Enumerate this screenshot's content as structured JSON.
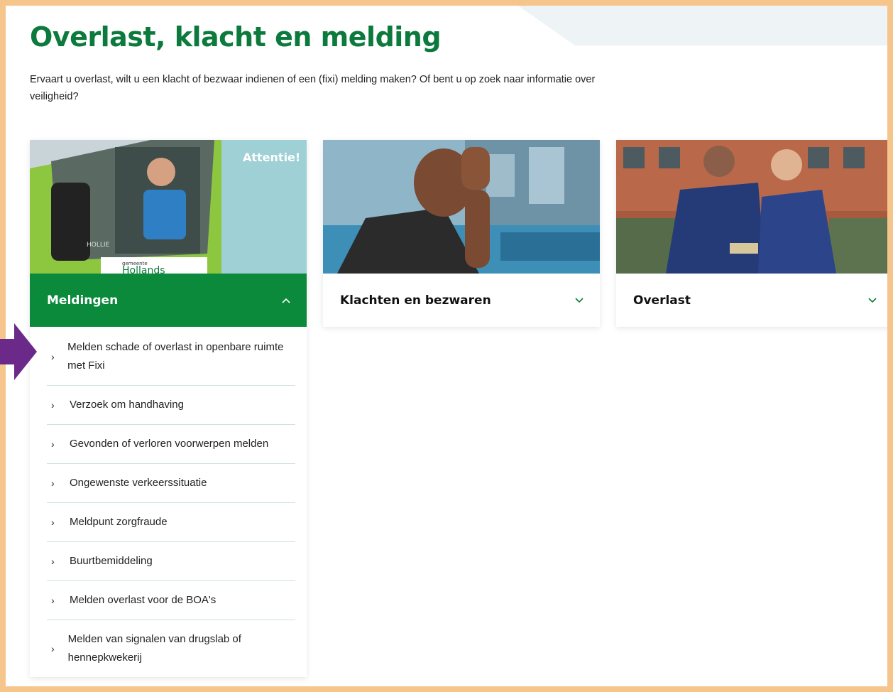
{
  "page": {
    "title": "Overlast, klacht en melding",
    "intro": "Ervaart u overlast, wilt u een klacht of bezwaar indienen of een (fixi) melding maken? Of bent u op zoek naar informatie over veiligheid?"
  },
  "cards": [
    {
      "label": "Meldingen",
      "chevron_icon": "chevron-up-icon",
      "image_text": [
        "Attentie!",
        "gemeente",
        "Hollands",
        "HOLLIE"
      ],
      "items": [
        {
          "label": "Melden schade of overlast in openbare ruimte met Fixi"
        },
        {
          "label": "Verzoek om handhaving"
        },
        {
          "label": "Gevonden of verloren voorwerpen melden"
        },
        {
          "label": "Ongewenste verkeerssituatie"
        },
        {
          "label": "Meldpunt zorgfraude"
        },
        {
          "label": "Buurtbemiddeling"
        },
        {
          "label": "Melden overlast voor de BOA's"
        },
        {
          "label": "Melden van signalen van drugslab of hennepkwekerij"
        }
      ]
    },
    {
      "label": "Klachten en bezwaren",
      "chevron_icon": "chevron-down-icon"
    },
    {
      "label": "Overlast",
      "chevron_icon": "chevron-down-icon"
    }
  ],
  "colors": {
    "brand_green": "#0c8a3c",
    "title_green": "#0c7a3c",
    "highlight_arrow": "#6b2a8a",
    "frame": "#f5c58c"
  }
}
